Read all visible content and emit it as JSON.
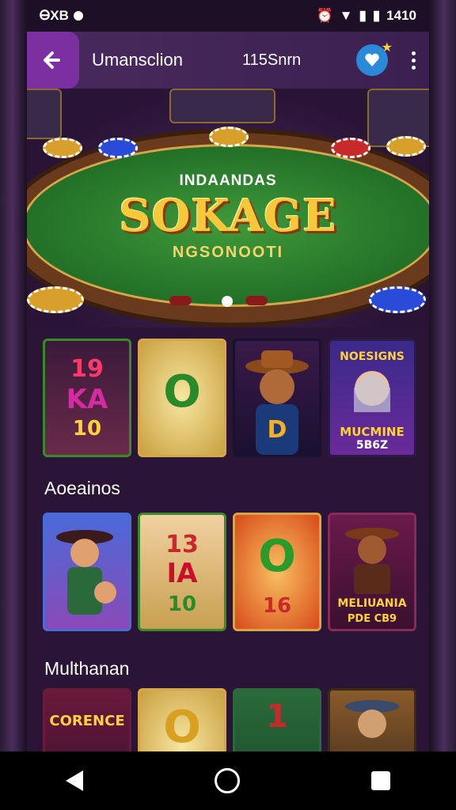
{
  "status_bar": {
    "left_text": "ᎾXB",
    "time": "1410"
  },
  "app_bar": {
    "title": "Umansclion",
    "subtitle": "115Snrn",
    "back_icon": "arrow-left-icon",
    "badge_icon": "heart-shield-icon",
    "more_icon": "more-vert-icon"
  },
  "hero": {
    "kicker": "INDAANDAS",
    "title": "SOKAGE",
    "subtitle": "NGSONOOTI"
  },
  "row1": {
    "tiles": [
      {
        "line1": "19",
        "line2": "KA",
        "line3": "10"
      },
      {
        "line1": "O",
        "line2": ""
      },
      {
        "line1": ""
      },
      {
        "line1": "NOESIGNS",
        "line2": "MUCMINE",
        "line3": "5B6Z"
      }
    ]
  },
  "section2": {
    "title": "Aoeainos"
  },
  "row2": {
    "tiles": [
      {
        "line1": ""
      },
      {
        "line1": "13",
        "line2": "IA",
        "line3": "10"
      },
      {
        "line1": "O",
        "line2": "16"
      },
      {
        "line1": "MELIUANIA",
        "line2": "PDE CB9"
      }
    ]
  },
  "section3": {
    "title": "Multhanan"
  },
  "row3": {
    "tiles": [
      {
        "line1": "CORENCE"
      },
      {
        "line1": "O"
      },
      {
        "line1": "1"
      },
      {
        "line1": ""
      }
    ]
  },
  "nav": {
    "back_icon": "back-triangle-icon",
    "home_icon": "home-circle-icon",
    "recent_icon": "recents-square-icon"
  }
}
